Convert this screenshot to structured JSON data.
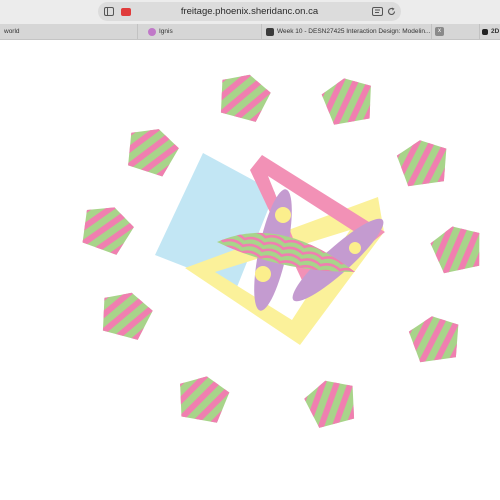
{
  "browser": {
    "url": "freitage.phoenix.sheridanc.on.ca",
    "tabs": [
      {
        "label": "world"
      },
      {
        "label": "Ignis"
      },
      {
        "label": "Week 10 - DESN27425 Interaction Design: Modelin..."
      },
      {
        "label": "2D"
      }
    ]
  },
  "colors": {
    "pentagon_green": "#a8d48a",
    "stripe_pink": "#f07fb0",
    "square_blue": "#c2e6f4",
    "frame_pink": "#f291b6",
    "frame_yellow": "#fbf19a",
    "petal_purple": "#c49bd0",
    "dot_yellow": "#fbee8c",
    "wave_green": "#a8d48a",
    "wave_pink": "#f07fb0"
  }
}
